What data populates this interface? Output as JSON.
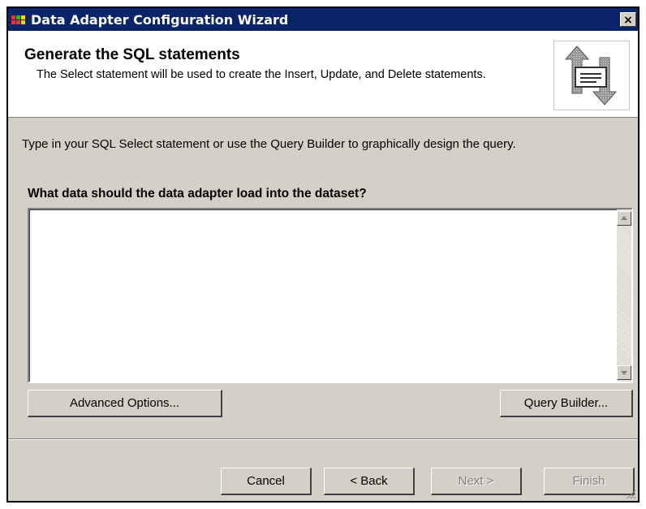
{
  "window": {
    "title": "Data Adapter Configuration Wizard",
    "close_glyph": "×"
  },
  "header": {
    "title": "Generate the SQL statements",
    "description": "The Select statement will be used to create the Insert, Update, and Delete statements.",
    "graphic_icon": "wizard-document-arrows-icon"
  },
  "body": {
    "instruction": "Type in your SQL Select statement or use the Query Builder to graphically design the query.",
    "question": "What data should the data adapter load into the dataset?",
    "sql_text": ""
  },
  "buttons": {
    "advanced_options": "Advanced Options...",
    "query_builder": "Query Builder...",
    "cancel": "Cancel",
    "back": "< Back",
    "next": "Next >",
    "finish": "Finish"
  },
  "colors": {
    "titlebar": "#0a246a",
    "dialog": "#d4d0c8",
    "disabled_text": "#808080"
  }
}
